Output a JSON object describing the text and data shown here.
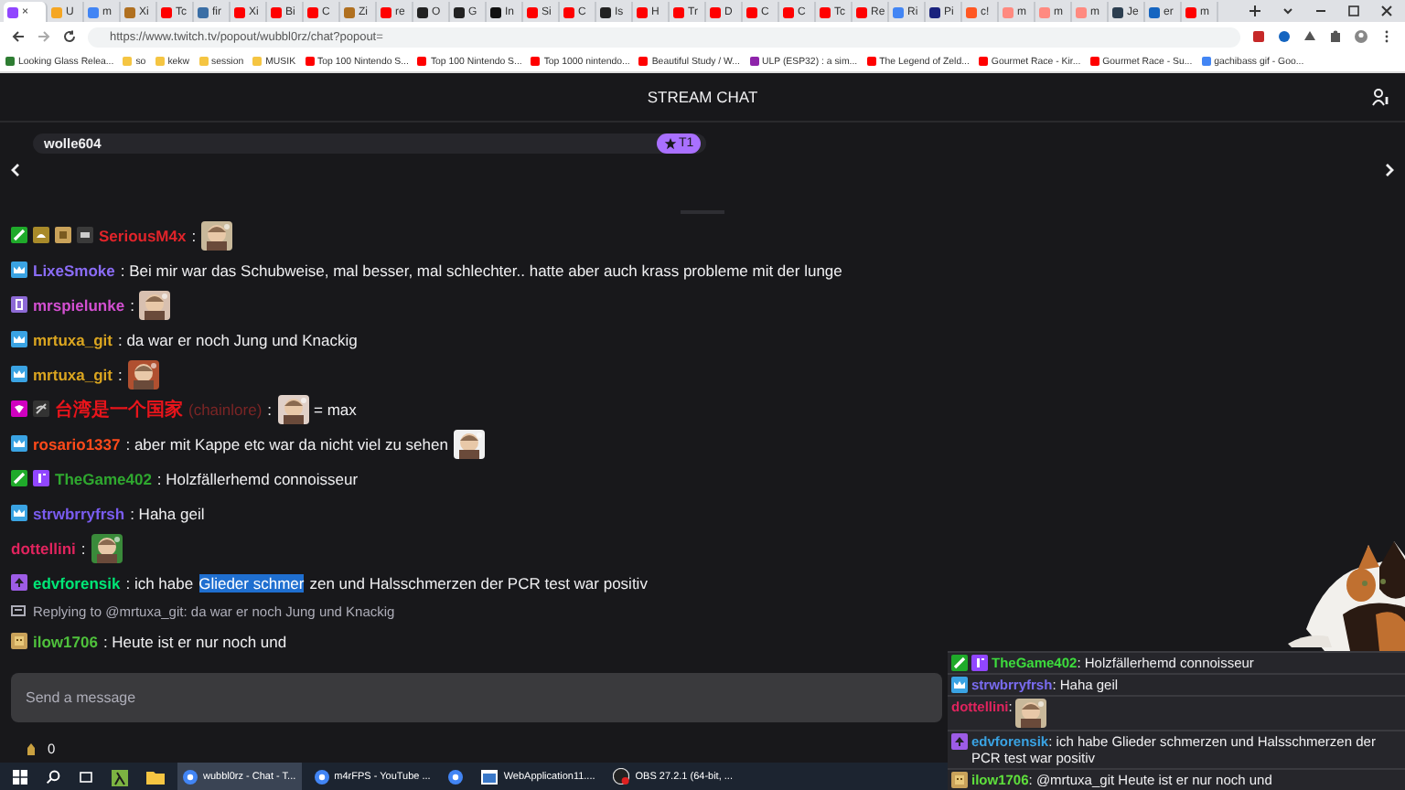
{
  "browser": {
    "tabs": [
      {
        "color": "#9146ff",
        "close": "×",
        "selected": true
      },
      {
        "label": "U",
        "color": "#f5a623",
        "selected": false
      },
      {
        "label": "m",
        "color": "#4285f4",
        "selected": false
      },
      {
        "label": "Xi",
        "color": "#b07020",
        "selected": false
      },
      {
        "label": "Tc",
        "color": "#ff0000",
        "selected": false
      },
      {
        "label": "fir",
        "color": "#3a6ea5",
        "selected": false
      },
      {
        "label": "Xi",
        "color": "#ff0000",
        "selected": false
      },
      {
        "label": "Bi",
        "color": "#ff0000",
        "selected": false
      },
      {
        "label": "C",
        "color": "#ff0000",
        "selected": false
      },
      {
        "label": "Zi",
        "color": "#b07020",
        "selected": false
      },
      {
        "label": "re",
        "color": "#ff0000",
        "selected": false
      },
      {
        "label": "O",
        "color": "#222222",
        "selected": false
      },
      {
        "label": "G",
        "color": "#222222",
        "selected": false
      },
      {
        "label": "In",
        "color": "#111111",
        "selected": false
      },
      {
        "label": "Si",
        "color": "#ff0000",
        "selected": false
      },
      {
        "label": "C",
        "color": "#ff0000",
        "selected": false
      },
      {
        "label": "Is",
        "color": "#222222",
        "selected": false
      },
      {
        "label": "H",
        "color": "#ff0000",
        "selected": false
      },
      {
        "label": "Tr",
        "color": "#ff0000",
        "selected": false
      },
      {
        "label": "D",
        "color": "#ff0000",
        "selected": false
      },
      {
        "label": "C",
        "color": "#ff0000",
        "selected": false
      },
      {
        "label": "C",
        "color": "#ff0000",
        "selected": false
      },
      {
        "label": "Tc",
        "color": "#ff0000",
        "selected": false
      },
      {
        "label": "Re",
        "color": "#ff0000",
        "selected": false
      },
      {
        "label": "Ri",
        "color": "#4285f4",
        "selected": false
      },
      {
        "label": "Pi",
        "color": "#1a237e",
        "selected": false
      },
      {
        "label": "c!",
        "color": "#ff5722",
        "selected": false
      },
      {
        "label": "m",
        "color": "#ff8a80",
        "selected": false
      },
      {
        "label": "m",
        "color": "#ff8a80",
        "selected": false
      },
      {
        "label": "m",
        "color": "#ff8a80",
        "selected": false
      },
      {
        "label": "Je",
        "color": "#2c3e50",
        "selected": false
      },
      {
        "label": "er",
        "color": "#1565c0",
        "selected": false
      },
      {
        "label": "m",
        "color": "#ff0000",
        "selected": false
      }
    ],
    "url": "https://www.twitch.tv/popout/wubbl0rz/chat?popout=",
    "bookmarks": [
      {
        "label": "Looking Glass Relea...",
        "color": "#2e7d32"
      },
      {
        "label": "so",
        "color": "#f5c542"
      },
      {
        "label": "kekw",
        "color": "#f5c542"
      },
      {
        "label": "session",
        "color": "#f5c542"
      },
      {
        "label": "MUSIK",
        "color": "#f5c542"
      },
      {
        "label": "Top 100 Nintendo S...",
        "color": "#ff0000"
      },
      {
        "label": "Top 100 Nintendo S...",
        "color": "#ff0000"
      },
      {
        "label": "Top 1000 nintendo...",
        "color": "#ff0000"
      },
      {
        "label": "Beautiful Study / W...",
        "color": "#ff0000"
      },
      {
        "label": "ULP (ESP32) : a sim...",
        "color": "#8e24aa"
      },
      {
        "label": "The Legend of Zeld...",
        "color": "#ff0000"
      },
      {
        "label": "Gourmet Race - Kir...",
        "color": "#ff0000"
      },
      {
        "label": "Gourmet Race - Su...",
        "color": "#ff0000"
      },
      {
        "label": "gachibass gif - Goo...",
        "color": "#4285f4"
      }
    ]
  },
  "chat": {
    "title": "STREAM CHAT",
    "pinned": {
      "user": "wolle604",
      "badge": "T1"
    },
    "messages": [
      {
        "badges": [
          {
            "kind": "sword"
          },
          {
            "kind": "hat"
          },
          {
            "kind": "box"
          },
          {
            "kind": "chip"
          }
        ],
        "user": "SeriousM4x",
        "color": "#e0242a",
        "parts": [
          {
            "kind": "text",
            "text": ":"
          },
          {
            "kind": "emote"
          }
        ]
      },
      {
        "badges": [
          {
            "kind": "crown"
          }
        ],
        "user": "LixeSmoke",
        "color": "#8a6cf5",
        "parts": [
          {
            "kind": "text",
            "text": ": Bei mir war das Schubweise, mal besser, mal schlechter.. hatte aber auch krass probleme mit der lunge"
          }
        ]
      },
      {
        "badges": [
          {
            "kind": "sub"
          }
        ],
        "user": "mrspielunke",
        "color": "#d24fd0",
        "parts": [
          {
            "kind": "text",
            "text": ":"
          },
          {
            "kind": "emote"
          }
        ]
      },
      {
        "badges": [
          {
            "kind": "crown"
          }
        ],
        "user": "mrtuxa_git",
        "color": "#daa520",
        "parts": [
          {
            "kind": "text",
            "text": ": da war er noch Jung und Knackig"
          }
        ]
      },
      {
        "badges": [
          {
            "kind": "crown"
          }
        ],
        "user": "mrtuxa_git",
        "color": "#daa520",
        "parts": [
          {
            "kind": "text",
            "text": ":"
          },
          {
            "kind": "emote"
          }
        ]
      },
      {
        "badges": [
          {
            "kind": "gem"
          },
          {
            "kind": "hidden"
          }
        ],
        "user": "台湾是一个国家",
        "login": "(chainlore)",
        "color": "#e8141b",
        "parts": [
          {
            "kind": "text",
            "text": ":"
          },
          {
            "kind": "emote"
          },
          {
            "kind": "text",
            "text": "= max"
          }
        ]
      },
      {
        "badges": [
          {
            "kind": "crown"
          }
        ],
        "user": "rosario1337",
        "color": "#ff4a1a",
        "parts": [
          {
            "kind": "text",
            "text": ": aber mit Kappe etc war da nicht viel zu sehen"
          },
          {
            "kind": "emote"
          }
        ]
      },
      {
        "badges": [
          {
            "kind": "sword"
          },
          {
            "kind": "tier"
          }
        ],
        "user": "TheGame402",
        "color": "#2fa82f",
        "parts": [
          {
            "kind": "text",
            "text": ": Holzfällerhemd connoisseur"
          }
        ]
      },
      {
        "badges": [
          {
            "kind": "crown"
          }
        ],
        "user": "strwbrryfrsh",
        "color": "#7a5cf0",
        "parts": [
          {
            "kind": "text",
            "text": ": Haha geil"
          }
        ]
      },
      {
        "user": "dottellini",
        "color": "#e0245e",
        "parts": [
          {
            "kind": "text",
            "text": ":"
          },
          {
            "kind": "emote"
          }
        ]
      },
      {
        "badges": [
          {
            "kind": "spade"
          }
        ],
        "user": "edvforensik",
        "color": "#00e676",
        "parts": [
          {
            "kind": "text",
            "text": ": ich habe"
          },
          {
            "kind": "selection",
            "text": "Glieder schmer"
          },
          {
            "kind": "text",
            "text": "zen und Halsschmerzen der PCR test war positiv"
          }
        ]
      }
    ],
    "reply": {
      "text": "Replying to @mrtuxa_git: da war er noch Jung und Knackig"
    },
    "reply_message": {
      "badges": [
        {
          "kind": "face"
        }
      ],
      "user": "ilow1706",
      "color": "#4fc13c",
      "parts": [
        {
          "kind": "text",
          "text": ": Heute ist er nur noch und"
        }
      ]
    },
    "input": {
      "placeholder": "Send a message"
    },
    "points": "0"
  },
  "overlay": {
    "messages": [
      {
        "badges": [
          {
            "kind": "sword"
          },
          {
            "kind": "tier"
          }
        ],
        "user": "TheGame402",
        "color": "#3ddc3d",
        "parts": [
          {
            "kind": "text",
            "text": ": Holzfällerhemd connoisseur"
          }
        ]
      },
      {
        "badges": [
          {
            "kind": "crown"
          }
        ],
        "user": "strwbrryfrsh",
        "color": "#7a6cf0",
        "parts": [
          {
            "kind": "text",
            "text": ": Haha geil"
          }
        ]
      },
      {
        "user": "dottellini",
        "color": "#e0245e",
        "parts": [
          {
            "kind": "text",
            "text": ":"
          },
          {
            "kind": "emote"
          }
        ]
      },
      {
        "badges": [
          {
            "kind": "spade"
          }
        ],
        "user": "edvforensik",
        "color": "#3aa3e3",
        "parts": [
          {
            "kind": "text",
            "text": ": ich habe Glieder schmerzen und Halsschmerzen der PCR test war positiv"
          }
        ]
      },
      {
        "badges": [
          {
            "kind": "face"
          }
        ],
        "user": "ilow1706",
        "color": "#5fe03c",
        "parts": [
          {
            "kind": "text",
            "text": ": @mrtuxa_git Heute ist er nur noch und"
          }
        ]
      }
    ]
  },
  "taskbar": {
    "items": [
      {
        "kind": "start"
      },
      {
        "kind": "search"
      },
      {
        "kind": "taskview"
      },
      {
        "kind": "lambda"
      },
      {
        "kind": "folder"
      },
      {
        "kind": "chrome",
        "label": "wubbl0rz - Chat - T...",
        "active": true
      },
      {
        "kind": "chrome",
        "label": "m4rFPS - YouTube ...",
        "active": false
      },
      {
        "kind": "chrome"
      },
      {
        "kind": "webapp",
        "label": "WebApplication11....",
        "active": false
      },
      {
        "kind": "obs",
        "label": "OBS 27.2.1 (64-bit, ...",
        "active": false
      }
    ]
  }
}
